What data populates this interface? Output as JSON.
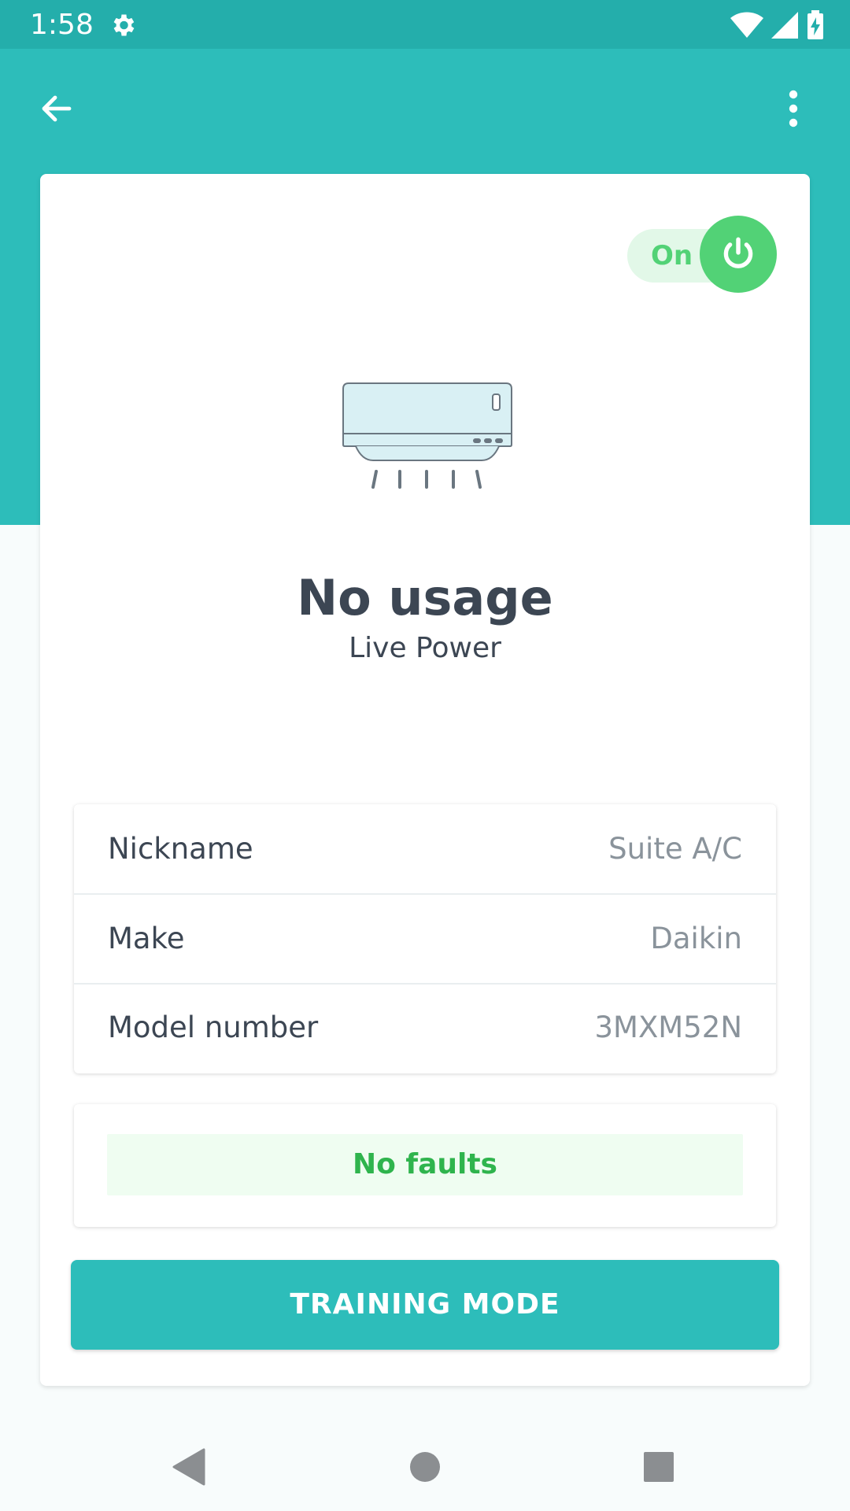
{
  "status_bar": {
    "time": "1:58",
    "icons": [
      "gear-icon",
      "wifi-icon",
      "signal-icon",
      "battery-charging-icon"
    ]
  },
  "app_bar": {
    "back_icon": "arrow-left-icon",
    "menu_icon": "more-vert-icon"
  },
  "device": {
    "power_toggle_label": "On",
    "power_state": true,
    "illustration": "air-conditioner-icon",
    "usage_title": "No usage",
    "usage_subtitle": "Live Power"
  },
  "details": [
    {
      "label": "Nickname",
      "value": "Suite A/C"
    },
    {
      "label": "Make",
      "value": "Daikin"
    },
    {
      "label": "Model number",
      "value": "3MXM52N"
    }
  ],
  "faults": {
    "status_text": "No faults"
  },
  "actions": {
    "training_mode_label": "TRAINING MODE"
  },
  "nav_bar": {
    "icons": [
      "back-triangle-icon",
      "home-circle-icon",
      "recents-square-icon"
    ]
  },
  "colors": {
    "primary": "#2dbdba",
    "status_bar": "#24aeab",
    "power_on": "#52d276",
    "fault_ok_text": "#2fb44d",
    "fault_ok_bg": "#effdf1",
    "text_dark": "#3c4653",
    "text_muted": "#8a939b"
  }
}
